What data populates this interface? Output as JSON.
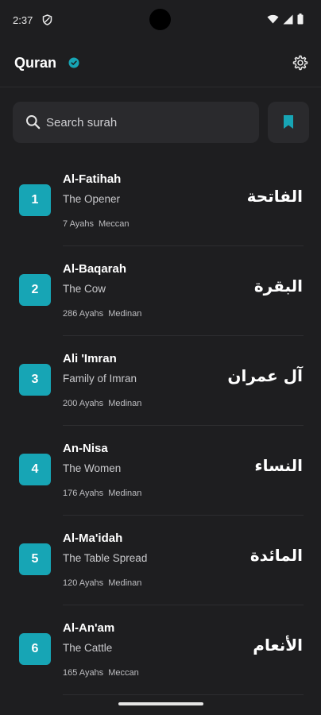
{
  "status_bar": {
    "time": "2:37"
  },
  "header": {
    "title": "Quran"
  },
  "search": {
    "placeholder": "Search surah",
    "value": ""
  },
  "colors": {
    "accent": "#17a5b5",
    "background": "#1e1e20",
    "surface": "#2a2a2d"
  },
  "surahs": [
    {
      "number": "1",
      "name": "Al-Fatihah",
      "meaning": "The Opener",
      "ayahs": "7 Ayahs",
      "type": "Meccan",
      "arabic": "الفاتحة"
    },
    {
      "number": "2",
      "name": "Al-Baqarah",
      "meaning": "The Cow",
      "ayahs": "286 Ayahs",
      "type": "Medinan",
      "arabic": "البقرة"
    },
    {
      "number": "3",
      "name": "Ali 'Imran",
      "meaning": "Family of Imran",
      "ayahs": "200 Ayahs",
      "type": "Medinan",
      "arabic": "آل عمران"
    },
    {
      "number": "4",
      "name": "An-Nisa",
      "meaning": "The Women",
      "ayahs": "176 Ayahs",
      "type": "Medinan",
      "arabic": "النساء"
    },
    {
      "number": "5",
      "name": "Al-Ma'idah",
      "meaning": "The Table Spread",
      "ayahs": "120 Ayahs",
      "type": "Medinan",
      "arabic": "المائدة"
    },
    {
      "number": "6",
      "name": "Al-An'am",
      "meaning": "The Cattle",
      "ayahs": "165 Ayahs",
      "type": "Meccan",
      "arabic": "الأنعام"
    }
  ],
  "icons": {
    "verified": "verified-icon",
    "settings": "gear-icon",
    "search": "search-icon",
    "bookmark": "bookmark-icon"
  }
}
